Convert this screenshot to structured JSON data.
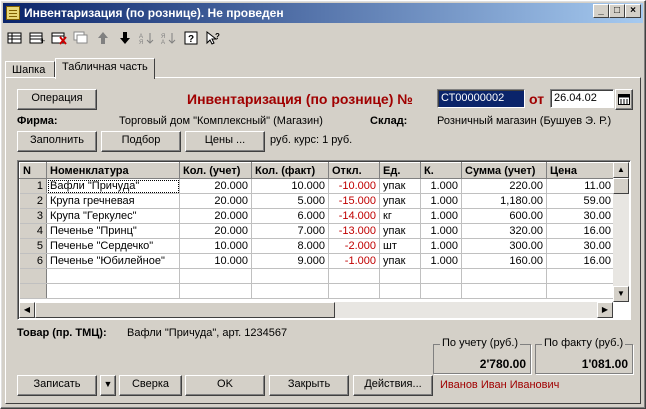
{
  "window": {
    "title": "Инвентаризация (по рознице). Не проведен"
  },
  "tabs": [
    {
      "label": "Шапка"
    },
    {
      "label": "Табличная часть"
    }
  ],
  "header": {
    "operation_button": "Операция",
    "doc_title": "Инвентаризация (по рознице) №",
    "doc_number": "СТ00000002",
    "from_label": "от",
    "doc_date": "26.04.02",
    "firm_label": "Фирма:",
    "firm_value": "Торговый дом \"Комплексный\" (Магазин)",
    "warehouse_label": "Склад:",
    "warehouse_value": "Розничный магазин (Бушуев Э. Р.)",
    "fill_button": "Заполнить",
    "select_button": "Подбор",
    "prices_button": "Цены ...",
    "rate_text": "руб. курс: 1 руб."
  },
  "table": {
    "columns": [
      "N",
      "Номенклатура",
      "Кол. (учет)",
      "Кол. (факт)",
      "Откл.",
      "Ед.",
      "К.",
      "Сумма (учет)",
      "Цена"
    ],
    "rows": [
      {
        "n": "1",
        "name": "Вафли \"Причуда\"",
        "qty_acc": "20.000",
        "qty_fact": "10.000",
        "dev": "-10.000",
        "unit": "упак",
        "k": "1.000",
        "sum_acc": "220.00",
        "price": "11.00"
      },
      {
        "n": "2",
        "name": "Крупа гречневая",
        "qty_acc": "20.000",
        "qty_fact": "5.000",
        "dev": "-15.000",
        "unit": "упак",
        "k": "1.000",
        "sum_acc": "1,180.00",
        "price": "59.00"
      },
      {
        "n": "3",
        "name": "Крупа \"Геркулес\"",
        "qty_acc": "20.000",
        "qty_fact": "6.000",
        "dev": "-14.000",
        "unit": "кг",
        "k": "1.000",
        "sum_acc": "600.00",
        "price": "30.00"
      },
      {
        "n": "4",
        "name": "Печенье \"Принц\"",
        "qty_acc": "20.000",
        "qty_fact": "7.000",
        "dev": "-13.000",
        "unit": "упак",
        "k": "1.000",
        "sum_acc": "320.00",
        "price": "16.00"
      },
      {
        "n": "5",
        "name": "Печенье \"Сердечко\"",
        "qty_acc": "10.000",
        "qty_fact": "8.000",
        "dev": "-2.000",
        "unit": "шт",
        "k": "1.000",
        "sum_acc": "300.00",
        "price": "30.00"
      },
      {
        "n": "6",
        "name": "Печенье \"Юбилейное\"",
        "qty_acc": "10.000",
        "qty_fact": "9.000",
        "dev": "-1.000",
        "unit": "упак",
        "k": "1.000",
        "sum_acc": "160.00",
        "price": "16.00"
      }
    ]
  },
  "footer": {
    "product_label": "Товар (пр. ТМЦ):",
    "product_value": "Вафли \"Причуда\", арт. 1234567",
    "total_acc_label": "По учету (руб.)",
    "total_acc_value": "2'780.00",
    "total_fact_label": "По факту (руб.)",
    "total_fact_value": "1'081.00",
    "save_button": "Записать",
    "check_button": "Сверка",
    "ok_button": "OK",
    "close_button": "Закрыть",
    "actions_button": "Действия...",
    "user_name": "Иванов Иван Иванович"
  },
  "colors": {
    "title_text": "#a00000",
    "deviation": "#c00000",
    "user_name": "#a00000",
    "titlebar_start": "#0a246a",
    "titlebar_end": "#a6caf0"
  },
  "icons": {
    "toolbar": [
      "new-row-icon",
      "add-row-icon",
      "delete-row-icon",
      "copy-row-icon",
      "move-up-icon",
      "move-down-icon",
      "sort-asc-icon",
      "sort-desc-icon",
      "help-icon",
      "context-help-icon"
    ]
  }
}
